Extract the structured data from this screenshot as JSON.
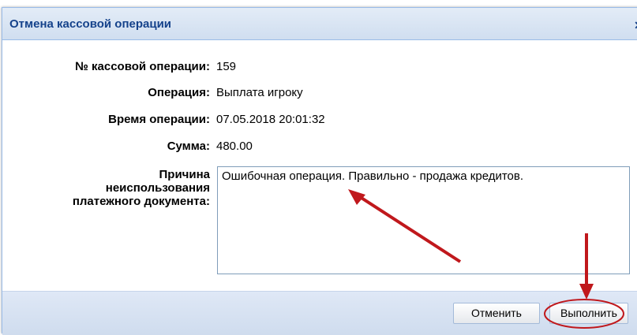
{
  "dialog": {
    "title": "Отмена кассовой операции",
    "close_glyph": "✕"
  },
  "fields": [
    {
      "label": "№ кассовой операции:",
      "value": "159"
    },
    {
      "label": "Операция:",
      "value": "Выплата игроку"
    },
    {
      "label": "Время операции:",
      "value": "07.05.2018 20:01:32"
    },
    {
      "label": "Сумма:",
      "value": "480.00"
    }
  ],
  "reason": {
    "label_line1": "Причина",
    "label_line2": "неиспользования",
    "label_line3": "платежного документа:",
    "value": "Ошибочная операция. Правильно - продажа кредитов."
  },
  "buttons": {
    "cancel": "Отменить",
    "execute": "Выполнить"
  },
  "annotation_color": "#c0181c"
}
